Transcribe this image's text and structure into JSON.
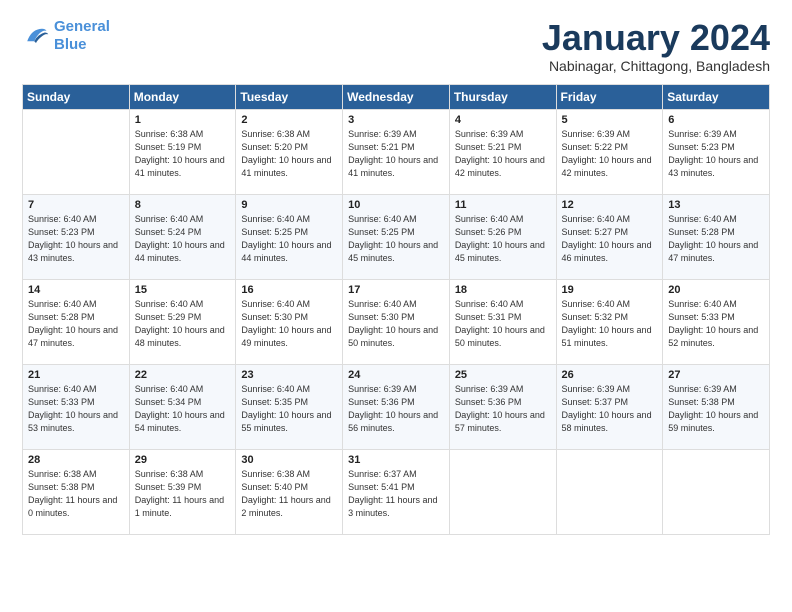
{
  "header": {
    "logo_line1": "General",
    "logo_line2": "Blue",
    "month_title": "January 2024",
    "location": "Nabinagar, Chittagong, Bangladesh"
  },
  "days_of_week": [
    "Sunday",
    "Monday",
    "Tuesday",
    "Wednesday",
    "Thursday",
    "Friday",
    "Saturday"
  ],
  "weeks": [
    [
      {
        "day": "",
        "sunrise": "",
        "sunset": "",
        "daylight": ""
      },
      {
        "day": "1",
        "sunrise": "Sunrise: 6:38 AM",
        "sunset": "Sunset: 5:19 PM",
        "daylight": "Daylight: 10 hours and 41 minutes."
      },
      {
        "day": "2",
        "sunrise": "Sunrise: 6:38 AM",
        "sunset": "Sunset: 5:20 PM",
        "daylight": "Daylight: 10 hours and 41 minutes."
      },
      {
        "day": "3",
        "sunrise": "Sunrise: 6:39 AM",
        "sunset": "Sunset: 5:21 PM",
        "daylight": "Daylight: 10 hours and 41 minutes."
      },
      {
        "day": "4",
        "sunrise": "Sunrise: 6:39 AM",
        "sunset": "Sunset: 5:21 PM",
        "daylight": "Daylight: 10 hours and 42 minutes."
      },
      {
        "day": "5",
        "sunrise": "Sunrise: 6:39 AM",
        "sunset": "Sunset: 5:22 PM",
        "daylight": "Daylight: 10 hours and 42 minutes."
      },
      {
        "day": "6",
        "sunrise": "Sunrise: 6:39 AM",
        "sunset": "Sunset: 5:23 PM",
        "daylight": "Daylight: 10 hours and 43 minutes."
      }
    ],
    [
      {
        "day": "7",
        "sunrise": "Sunrise: 6:40 AM",
        "sunset": "Sunset: 5:23 PM",
        "daylight": "Daylight: 10 hours and 43 minutes."
      },
      {
        "day": "8",
        "sunrise": "Sunrise: 6:40 AM",
        "sunset": "Sunset: 5:24 PM",
        "daylight": "Daylight: 10 hours and 44 minutes."
      },
      {
        "day": "9",
        "sunrise": "Sunrise: 6:40 AM",
        "sunset": "Sunset: 5:25 PM",
        "daylight": "Daylight: 10 hours and 44 minutes."
      },
      {
        "day": "10",
        "sunrise": "Sunrise: 6:40 AM",
        "sunset": "Sunset: 5:25 PM",
        "daylight": "Daylight: 10 hours and 45 minutes."
      },
      {
        "day": "11",
        "sunrise": "Sunrise: 6:40 AM",
        "sunset": "Sunset: 5:26 PM",
        "daylight": "Daylight: 10 hours and 45 minutes."
      },
      {
        "day": "12",
        "sunrise": "Sunrise: 6:40 AM",
        "sunset": "Sunset: 5:27 PM",
        "daylight": "Daylight: 10 hours and 46 minutes."
      },
      {
        "day": "13",
        "sunrise": "Sunrise: 6:40 AM",
        "sunset": "Sunset: 5:28 PM",
        "daylight": "Daylight: 10 hours and 47 minutes."
      }
    ],
    [
      {
        "day": "14",
        "sunrise": "Sunrise: 6:40 AM",
        "sunset": "Sunset: 5:28 PM",
        "daylight": "Daylight: 10 hours and 47 minutes."
      },
      {
        "day": "15",
        "sunrise": "Sunrise: 6:40 AM",
        "sunset": "Sunset: 5:29 PM",
        "daylight": "Daylight: 10 hours and 48 minutes."
      },
      {
        "day": "16",
        "sunrise": "Sunrise: 6:40 AM",
        "sunset": "Sunset: 5:30 PM",
        "daylight": "Daylight: 10 hours and 49 minutes."
      },
      {
        "day": "17",
        "sunrise": "Sunrise: 6:40 AM",
        "sunset": "Sunset: 5:30 PM",
        "daylight": "Daylight: 10 hours and 50 minutes."
      },
      {
        "day": "18",
        "sunrise": "Sunrise: 6:40 AM",
        "sunset": "Sunset: 5:31 PM",
        "daylight": "Daylight: 10 hours and 50 minutes."
      },
      {
        "day": "19",
        "sunrise": "Sunrise: 6:40 AM",
        "sunset": "Sunset: 5:32 PM",
        "daylight": "Daylight: 10 hours and 51 minutes."
      },
      {
        "day": "20",
        "sunrise": "Sunrise: 6:40 AM",
        "sunset": "Sunset: 5:33 PM",
        "daylight": "Daylight: 10 hours and 52 minutes."
      }
    ],
    [
      {
        "day": "21",
        "sunrise": "Sunrise: 6:40 AM",
        "sunset": "Sunset: 5:33 PM",
        "daylight": "Daylight: 10 hours and 53 minutes."
      },
      {
        "day": "22",
        "sunrise": "Sunrise: 6:40 AM",
        "sunset": "Sunset: 5:34 PM",
        "daylight": "Daylight: 10 hours and 54 minutes."
      },
      {
        "day": "23",
        "sunrise": "Sunrise: 6:40 AM",
        "sunset": "Sunset: 5:35 PM",
        "daylight": "Daylight: 10 hours and 55 minutes."
      },
      {
        "day": "24",
        "sunrise": "Sunrise: 6:39 AM",
        "sunset": "Sunset: 5:36 PM",
        "daylight": "Daylight: 10 hours and 56 minutes."
      },
      {
        "day": "25",
        "sunrise": "Sunrise: 6:39 AM",
        "sunset": "Sunset: 5:36 PM",
        "daylight": "Daylight: 10 hours and 57 minutes."
      },
      {
        "day": "26",
        "sunrise": "Sunrise: 6:39 AM",
        "sunset": "Sunset: 5:37 PM",
        "daylight": "Daylight: 10 hours and 58 minutes."
      },
      {
        "day": "27",
        "sunrise": "Sunrise: 6:39 AM",
        "sunset": "Sunset: 5:38 PM",
        "daylight": "Daylight: 10 hours and 59 minutes."
      }
    ],
    [
      {
        "day": "28",
        "sunrise": "Sunrise: 6:38 AM",
        "sunset": "Sunset: 5:38 PM",
        "daylight": "Daylight: 11 hours and 0 minutes."
      },
      {
        "day": "29",
        "sunrise": "Sunrise: 6:38 AM",
        "sunset": "Sunset: 5:39 PM",
        "daylight": "Daylight: 11 hours and 1 minute."
      },
      {
        "day": "30",
        "sunrise": "Sunrise: 6:38 AM",
        "sunset": "Sunset: 5:40 PM",
        "daylight": "Daylight: 11 hours and 2 minutes."
      },
      {
        "day": "31",
        "sunrise": "Sunrise: 6:37 AM",
        "sunset": "Sunset: 5:41 PM",
        "daylight": "Daylight: 11 hours and 3 minutes."
      },
      {
        "day": "",
        "sunrise": "",
        "sunset": "",
        "daylight": ""
      },
      {
        "day": "",
        "sunrise": "",
        "sunset": "",
        "daylight": ""
      },
      {
        "day": "",
        "sunrise": "",
        "sunset": "",
        "daylight": ""
      }
    ]
  ]
}
